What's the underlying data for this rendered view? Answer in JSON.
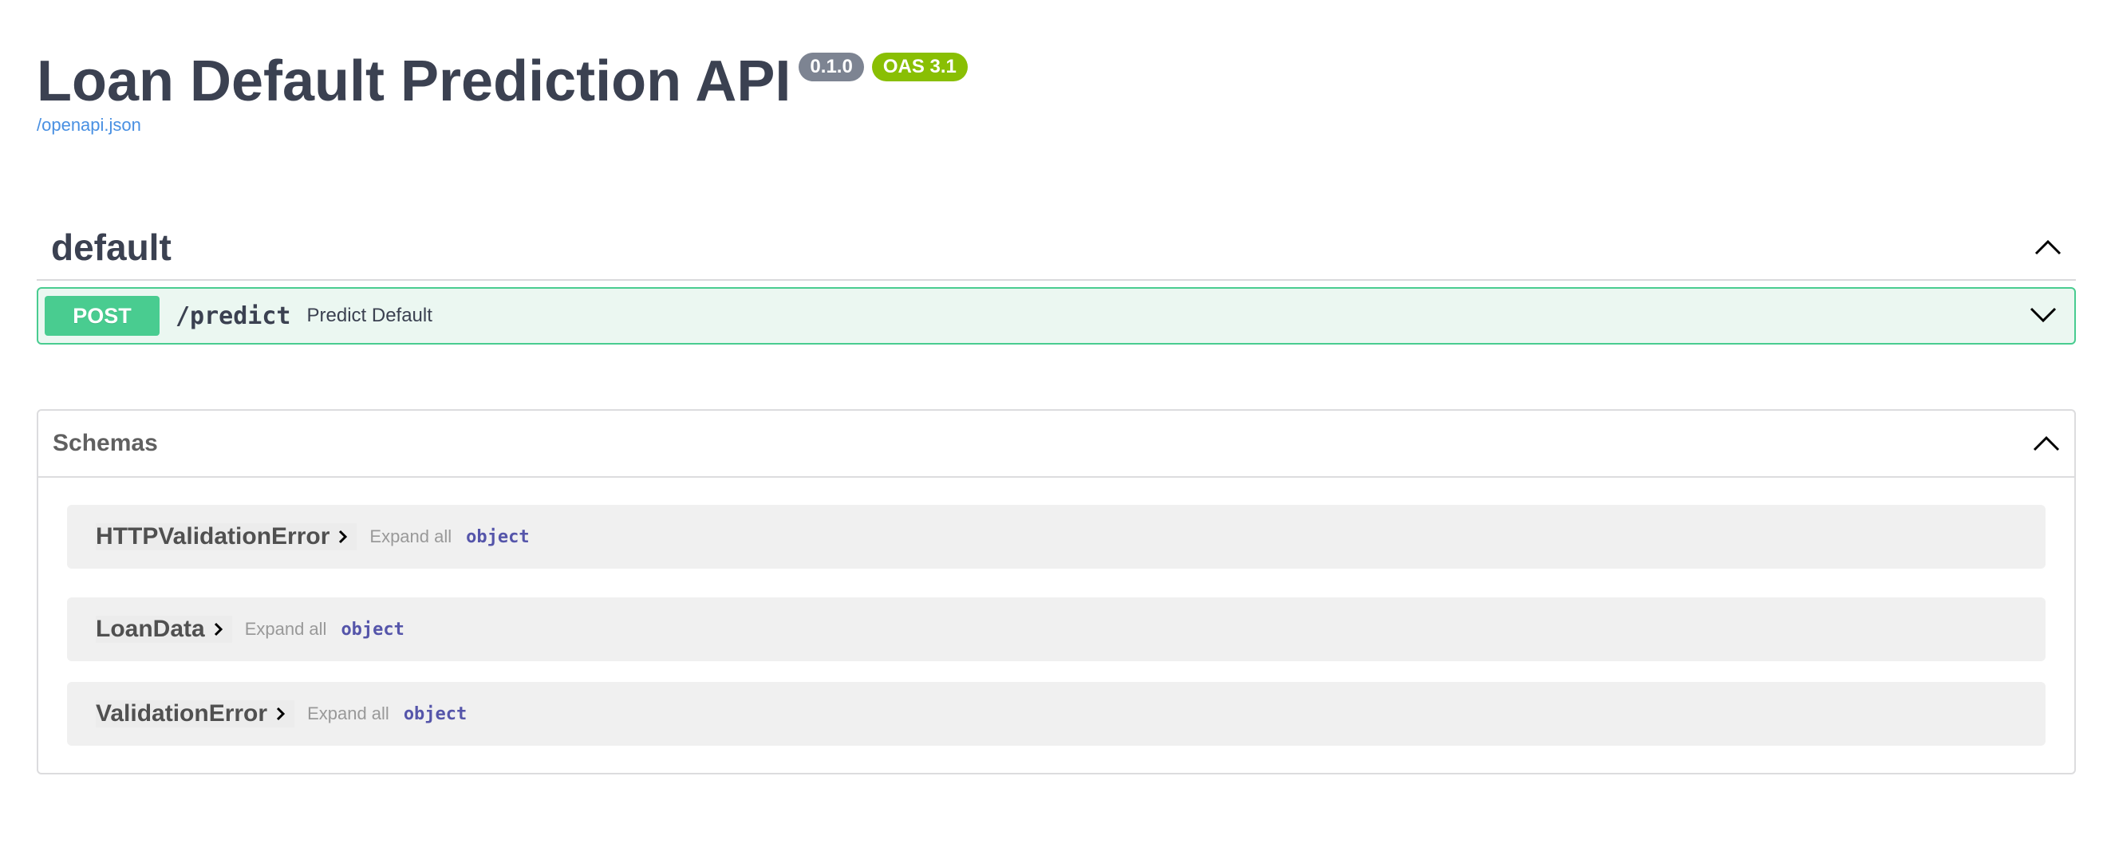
{
  "info": {
    "title": "Loan Default Prediction API",
    "version_badge": "0.1.0",
    "oas_badge": "OAS 3.1",
    "spec_link": "/openapi.json"
  },
  "tag": {
    "name": "default",
    "operation": {
      "method": "POST",
      "path": "/predict",
      "summary": "Predict Default"
    }
  },
  "schemas": {
    "title": "Schemas",
    "items": [
      {
        "name": "HTTPValidationError",
        "expand_label": "Expand all",
        "type": "object"
      },
      {
        "name": "LoanData",
        "expand_label": "Expand all",
        "type": "object"
      },
      {
        "name": "ValidationError",
        "expand_label": "Expand all",
        "type": "object"
      }
    ]
  },
  "colors": {
    "post_accent": "#49cc90",
    "post_background": "#ebf7f1",
    "version_badge": "#7d8492",
    "oas_badge": "#89bf04",
    "link": "#4990e2",
    "type_label": "#5555aa"
  },
  "icons": {
    "tag_toggle": "chevron-up-icon",
    "operation_toggle": "chevron-down-icon",
    "schemas_toggle": "chevron-up-icon",
    "model_expand": "chevron-right-icon"
  }
}
